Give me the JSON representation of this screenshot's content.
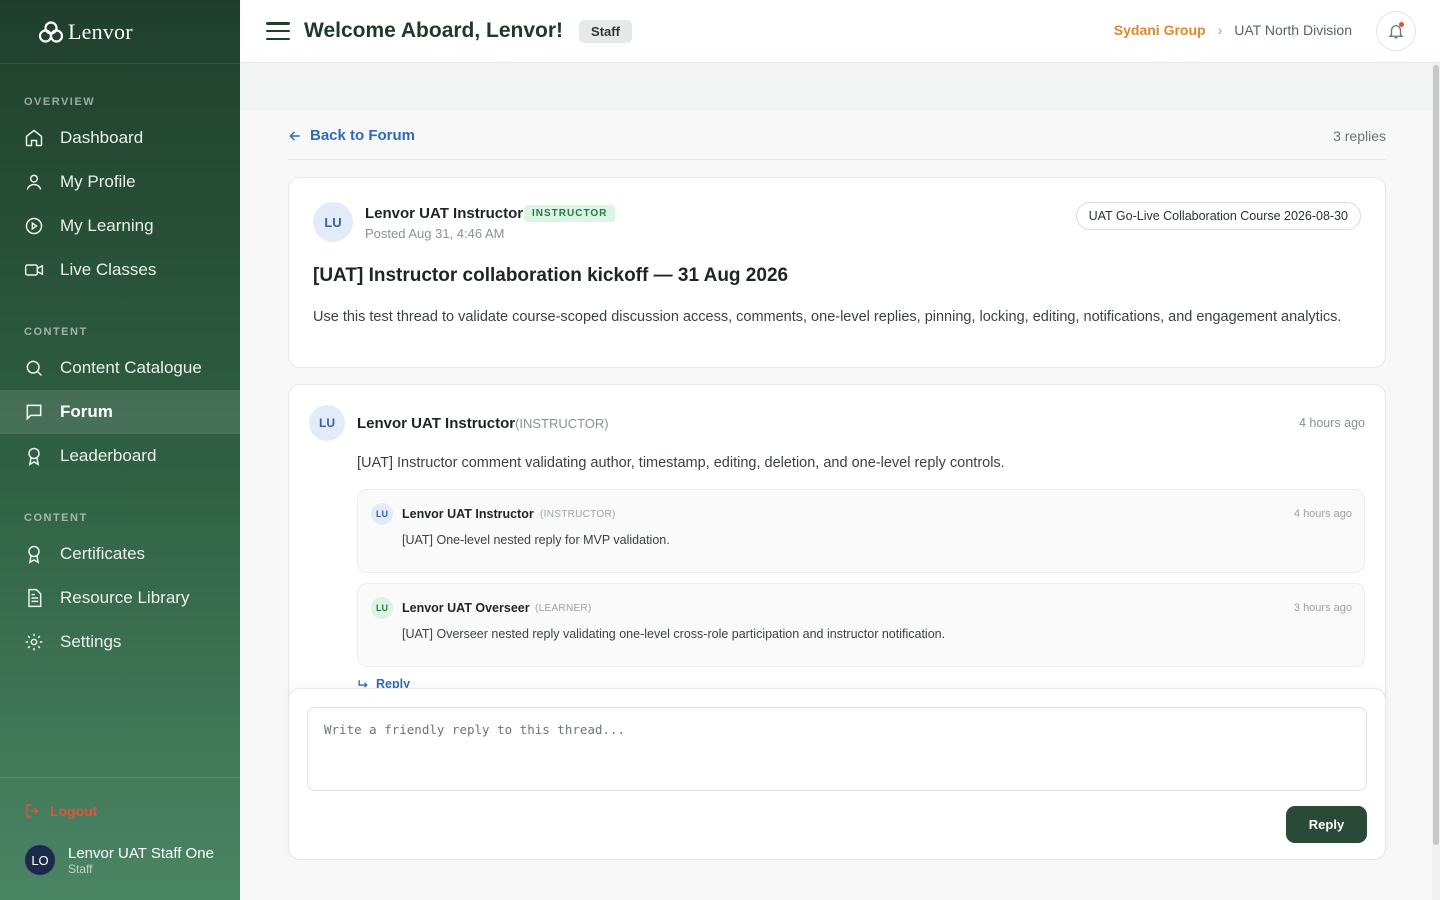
{
  "brand": {
    "name": "Lenvor"
  },
  "sidebar": {
    "sections": [
      {
        "title": "OVERVIEW",
        "items": [
          {
            "label": "Dashboard",
            "icon": "home-icon"
          },
          {
            "label": "My Profile",
            "icon": "user-icon"
          },
          {
            "label": "My Learning",
            "icon": "play-circle-icon"
          },
          {
            "label": "Live Classes",
            "icon": "video-icon"
          }
        ]
      },
      {
        "title": "CONTENT",
        "items": [
          {
            "label": "Content Catalogue",
            "icon": "search-icon"
          },
          {
            "label": "Forum",
            "icon": "message-icon",
            "active": true
          },
          {
            "label": "Leaderboard",
            "icon": "award-icon"
          }
        ]
      },
      {
        "title": "CONTENT",
        "items": [
          {
            "label": "Certificates",
            "icon": "award-icon"
          },
          {
            "label": "Resource Library",
            "icon": "file-icon"
          },
          {
            "label": "Settings",
            "icon": "gear-icon"
          }
        ]
      }
    ],
    "logout": "Logout",
    "user": {
      "initials": "LO",
      "name": "Lenvor UAT Staff One",
      "role": "Staff"
    }
  },
  "header": {
    "welcome": "Welcome Aboard, Lenvor!",
    "badge": "Staff",
    "breadcrumb": {
      "org": "Sydani Group",
      "division": "UAT North Division"
    }
  },
  "thread": {
    "back_label": "Back to Forum",
    "reply_count": "3 replies",
    "post": {
      "initials": "LU",
      "author": "Lenvor UAT Instructor",
      "role_tag": "INSTRUCTOR",
      "posted": "Posted Aug 31, 4:46 AM",
      "course": "UAT Go-Live Collaboration Course 2026-08-30",
      "title": "[UAT] Instructor collaboration kickoff — 31 Aug 2026",
      "body": "Use this test thread to validate course-scoped discussion access, comments, one-level replies, pinning, locking, editing, notifications, and engagement analytics."
    },
    "comment": {
      "initials": "LU",
      "author": "Lenvor UAT Instructor",
      "role": "(INSTRUCTOR)",
      "time": "4 hours ago",
      "body": "[UAT] Instructor comment validating author, timestamp, editing, deletion, and one-level reply controls.",
      "replies": [
        {
          "initials": "LU",
          "author": "Lenvor UAT Instructor",
          "role": "(INSTRUCTOR)",
          "time": "4 hours ago",
          "body": "[UAT] One-level nested reply for MVP validation."
        },
        {
          "initials": "LU",
          "author": "Lenvor UAT Overseer",
          "role": "(LEARNER)",
          "time": "3 hours ago",
          "body": "[UAT] Overseer nested reply validating one-level cross-role participation and instructor notification."
        }
      ],
      "reply_label": "Reply"
    },
    "composer": {
      "placeholder": "Write a friendly reply to this thread...",
      "button": "Reply"
    }
  },
  "colors": {
    "sidebar": "#2f5f42",
    "accent": "#2f6bb5",
    "org": "#e2862a",
    "primary_button": "#284a36"
  }
}
